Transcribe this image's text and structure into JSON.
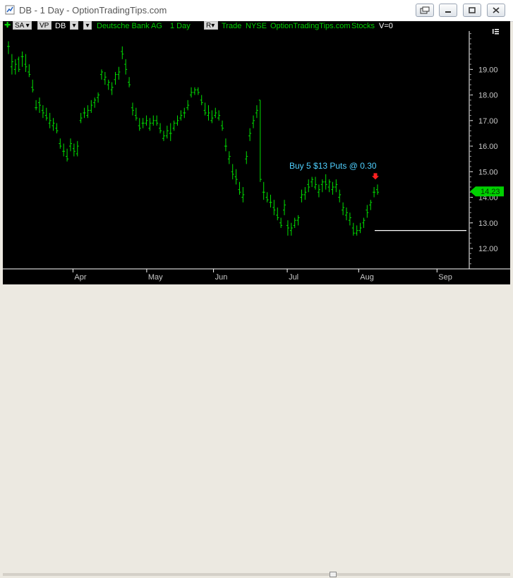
{
  "window": {
    "title": "DB - 1 Day - OptionTradingTips.com"
  },
  "toolbar": {
    "sa_label": "SA",
    "vp_label": "VP",
    "symbol": "DB",
    "company": "Deutsche Bank AG",
    "interval": "1 Day",
    "r_label": "R",
    "trade_label": "Trade",
    "exchange": "NYSE",
    "source": "OptionTradingTips.com",
    "category": "Stocks",
    "volume": "V=0"
  },
  "annotation": {
    "text": "Buy 5 $13 Puts @ 0.30"
  },
  "price_tag": "14.23",
  "colors": {
    "bars": "#00e000",
    "axis_text": "#c8c8c8",
    "annotation": "#4fd0ff",
    "price_tag_bg": "#00d000",
    "arrow": "#ff2020",
    "background": "#000000"
  },
  "chart_data": {
    "type": "ohlc",
    "y_ticks": [
      "12.00",
      "13.00",
      "14.00",
      "15.00",
      "16.00",
      "17.00",
      "18.00",
      "19.00"
    ],
    "x_ticks": [
      "Apr",
      "May",
      "Jun",
      "Jul",
      "Aug",
      "Sep"
    ],
    "ylim": [
      11.2,
      20.5
    ],
    "last_price": 14.23,
    "target_line": 12.7,
    "bars": [
      [
        19.9,
        20.1,
        19.6,
        19.9
      ],
      [
        19.1,
        19.6,
        18.8,
        19.3
      ],
      [
        19.0,
        19.4,
        18.8,
        19.2
      ],
      [
        19.4,
        19.5,
        18.9,
        19.0
      ],
      [
        19.5,
        19.7,
        19.1,
        19.5
      ],
      [
        19.2,
        19.6,
        18.9,
        19.1
      ],
      [
        18.9,
        19.2,
        18.7,
        18.8
      ],
      [
        18.3,
        18.6,
        18.1,
        18.2
      ],
      [
        17.5,
        17.8,
        17.4,
        17.5
      ],
      [
        17.7,
        17.9,
        17.3,
        17.6
      ],
      [
        17.4,
        17.6,
        17.1,
        17.3
      ],
      [
        17.2,
        17.5,
        17.0,
        17.1
      ],
      [
        16.9,
        17.3,
        16.7,
        17.0
      ],
      [
        16.8,
        17.1,
        16.6,
        16.9
      ],
      [
        16.7,
        16.9,
        16.5,
        16.6
      ],
      [
        16.1,
        16.3,
        15.9,
        16.0
      ],
      [
        15.8,
        16.1,
        15.6,
        15.8
      ],
      [
        15.6,
        15.9,
        15.4,
        15.5
      ],
      [
        16.0,
        16.3,
        15.8,
        16.1
      ],
      [
        15.9,
        16.1,
        15.6,
        15.8
      ],
      [
        15.7,
        16.2,
        15.6,
        16.0
      ],
      [
        17.0,
        17.3,
        16.9,
        17.1
      ],
      [
        17.3,
        17.5,
        17.1,
        17.3
      ],
      [
        17.2,
        17.6,
        17.1,
        17.4
      ],
      [
        17.4,
        17.8,
        17.3,
        17.6
      ],
      [
        17.7,
        17.9,
        17.5,
        17.8
      ],
      [
        17.9,
        18.1,
        17.7,
        18.0
      ],
      [
        18.8,
        19.0,
        18.6,
        18.9
      ],
      [
        18.6,
        18.9,
        18.4,
        18.7
      ],
      [
        18.4,
        18.6,
        18.2,
        18.5
      ],
      [
        18.2,
        18.5,
        18.0,
        18.3
      ],
      [
        18.6,
        18.9,
        18.4,
        18.8
      ],
      [
        18.8,
        19.1,
        18.6,
        18.9
      ],
      [
        19.7,
        19.9,
        19.4,
        19.6
      ],
      [
        19.2,
        19.4,
        18.8,
        19.0
      ],
      [
        18.5,
        18.7,
        18.3,
        18.4
      ],
      [
        17.5,
        17.7,
        17.2,
        17.4
      ],
      [
        17.2,
        17.5,
        17.0,
        17.1
      ],
      [
        16.8,
        17.1,
        16.6,
        16.7
      ],
      [
        16.9,
        17.1,
        16.7,
        16.9
      ],
      [
        16.9,
        17.2,
        16.8,
        17.0
      ],
      [
        16.7,
        17.1,
        16.6,
        16.9
      ],
      [
        16.9,
        17.2,
        16.8,
        17.0
      ],
      [
        17.0,
        17.2,
        16.8,
        16.9
      ],
      [
        16.7,
        16.9,
        16.5,
        16.6
      ],
      [
        16.3,
        16.6,
        16.2,
        16.4
      ],
      [
        16.4,
        16.8,
        16.3,
        16.6
      ],
      [
        16.5,
        16.9,
        16.2,
        16.5
      ],
      [
        16.7,
        17.0,
        16.6,
        16.9
      ],
      [
        16.9,
        17.2,
        16.8,
        17.0
      ],
      [
        17.1,
        17.4,
        17.0,
        17.2
      ],
      [
        17.3,
        17.5,
        17.1,
        17.3
      ],
      [
        17.5,
        17.8,
        17.4,
        17.6
      ],
      [
        18.0,
        18.3,
        17.9,
        18.1
      ],
      [
        18.1,
        18.3,
        18.0,
        18.2
      ],
      [
        18.2,
        18.3,
        18.0,
        18.1
      ],
      [
        17.8,
        18.0,
        17.6,
        17.7
      ],
      [
        17.4,
        17.7,
        17.2,
        17.3
      ],
      [
        17.2,
        17.6,
        17.0,
        17.3
      ],
      [
        17.0,
        17.4,
        16.9,
        17.1
      ],
      [
        17.2,
        17.5,
        17.1,
        17.3
      ],
      [
        17.1,
        17.4,
        17.0,
        17.2
      ],
      [
        16.8,
        17.0,
        16.6,
        16.7
      ],
      [
        16.0,
        16.3,
        15.8,
        16.0
      ],
      [
        15.5,
        15.8,
        15.3,
        15.6
      ],
      [
        15.0,
        15.3,
        14.7,
        14.9
      ],
      [
        14.8,
        15.1,
        14.5,
        14.7
      ],
      [
        14.3,
        14.6,
        14.1,
        14.2
      ],
      [
        14.0,
        14.4,
        13.8,
        14.1
      ],
      [
        15.5,
        15.8,
        15.3,
        15.6
      ],
      [
        16.4,
        16.7,
        16.2,
        16.5
      ],
      [
        16.9,
        17.2,
        16.7,
        17.0
      ],
      [
        17.3,
        17.6,
        17.1,
        17.4
      ],
      [
        17.8,
        17.8,
        14.6,
        14.7
      ],
      [
        14.2,
        14.6,
        13.9,
        14.2
      ],
      [
        14.0,
        14.2,
        13.8,
        13.9
      ],
      [
        13.8,
        14.1,
        13.6,
        13.8
      ],
      [
        13.6,
        13.9,
        13.3,
        13.5
      ],
      [
        13.3,
        13.6,
        13.1,
        13.2
      ],
      [
        13.0,
        13.2,
        12.8,
        12.9
      ],
      [
        13.5,
        13.9,
        13.3,
        13.7
      ],
      [
        12.9,
        13.1,
        12.5,
        12.8
      ],
      [
        12.7,
        13.0,
        12.5,
        12.8
      ],
      [
        12.9,
        13.2,
        12.8,
        13.1
      ],
      [
        13.1,
        13.3,
        12.9,
        13.2
      ],
      [
        14.0,
        14.3,
        13.8,
        14.1
      ],
      [
        14.1,
        14.4,
        13.9,
        14.2
      ],
      [
        14.5,
        14.7,
        14.2,
        14.4
      ],
      [
        14.6,
        14.8,
        14.4,
        14.7
      ],
      [
        14.4,
        14.8,
        14.3,
        14.5
      ],
      [
        14.2,
        14.5,
        14.0,
        14.3
      ],
      [
        14.5,
        14.7,
        14.2,
        14.6
      ],
      [
        14.6,
        14.9,
        14.3,
        14.5
      ],
      [
        14.4,
        14.7,
        14.2,
        14.6
      ],
      [
        14.3,
        14.6,
        14.1,
        14.4
      ],
      [
        14.4,
        14.7,
        14.2,
        14.5
      ],
      [
        14.0,
        14.3,
        13.8,
        14.1
      ],
      [
        13.5,
        13.8,
        13.3,
        13.6
      ],
      [
        13.3,
        13.6,
        13.1,
        13.4
      ],
      [
        13.1,
        13.4,
        12.9,
        13.2
      ],
      [
        12.8,
        13.0,
        12.5,
        12.6
      ],
      [
        12.6,
        12.9,
        12.5,
        12.7
      ],
      [
        12.7,
        13.0,
        12.6,
        12.8
      ],
      [
        13.0,
        13.2,
        12.8,
        13.1
      ],
      [
        13.5,
        13.7,
        13.2,
        13.4
      ],
      [
        13.7,
        13.9,
        13.5,
        13.8
      ],
      [
        14.2,
        14.4,
        14.0,
        14.2
      ],
      [
        14.3,
        14.5,
        14.1,
        14.2
      ]
    ]
  }
}
